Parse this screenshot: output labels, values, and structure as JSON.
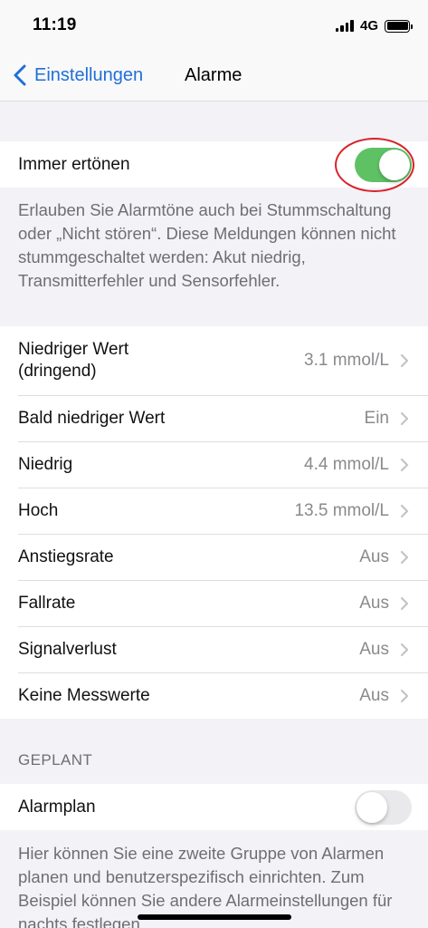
{
  "status_bar": {
    "time": "11:19",
    "network": "4G"
  },
  "nav": {
    "back_label": "Einstellungen",
    "title": "Alarme"
  },
  "always_sound": {
    "label": "Immer ertönen",
    "toggle_on": true,
    "description": "Erlauben Sie Alarmtöne auch bei Stummschaltung oder „Nicht stören“. Diese Meldungen können nicht stummgeschaltet werden: Akut niedrig, Transmitterfehler und Sensorfehler."
  },
  "alarms": [
    {
      "label": "Niedriger Wert (dringend)",
      "value": "3.1 mmol/L"
    },
    {
      "label": "Bald niedriger Wert",
      "value": "Ein"
    },
    {
      "label": "Niedrig",
      "value": "4.4 mmol/L"
    },
    {
      "label": "Hoch",
      "value": "13.5 mmol/L"
    },
    {
      "label": "Anstiegsrate",
      "value": "Aus"
    },
    {
      "label": "Fallrate",
      "value": "Aus"
    },
    {
      "label": "Signalverlust",
      "value": "Aus"
    },
    {
      "label": "Keine Messwerte",
      "value": "Aus"
    }
  ],
  "scheduled": {
    "header": "GEPLANT",
    "label": "Alarmplan",
    "toggle_on": false,
    "description": "Hier können Sie eine zweite Gruppe von Alarmen planen und benutzerspezifisch einrichten. Zum Beispiel können Sie andere Alarmeinstellungen für nachts festlegen."
  },
  "colors": {
    "accent": "#1f6fd8",
    "toggle_on": "#5ec264",
    "highlight": "#d9222a"
  }
}
